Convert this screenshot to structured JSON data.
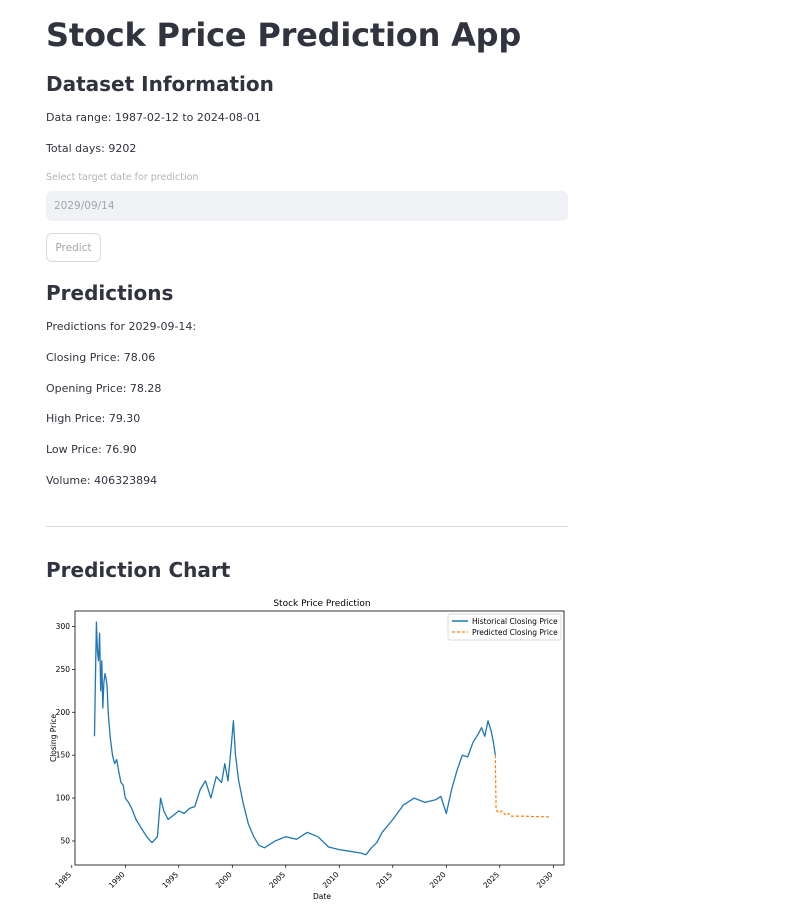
{
  "app": {
    "title": "Stock Price Prediction App"
  },
  "dataset": {
    "heading": "Dataset Information",
    "range_text": "Data range: 1987-02-12 to 2024-08-01",
    "total_days_text": "Total days: 9202"
  },
  "date_input": {
    "label": "Select target date for prediction",
    "value": "2029/09/14"
  },
  "predict_button": {
    "label": "Predict"
  },
  "predictions": {
    "heading": "Predictions",
    "for_text": "Predictions for 2029-09-14:",
    "closing": "Closing Price: 78.06",
    "opening": "Opening Price: 78.28",
    "high": "High Price: 79.30",
    "low": "Low Price: 76.90",
    "volume": "Volume: 406323894"
  },
  "chart_section": {
    "heading": "Prediction Chart"
  },
  "colors": {
    "historical": "#1f77b4",
    "predicted": "#ff7f0e"
  },
  "chart_data": {
    "type": "line",
    "title": "Stock Price Prediction",
    "xlabel": "Date",
    "ylabel": "Closing Price",
    "xlim": [
      1985.3,
      2031.0
    ],
    "ylim": [
      22,
      318
    ],
    "xticks": [
      1985,
      1990,
      1995,
      2000,
      2005,
      2010,
      2015,
      2020,
      2025,
      2030
    ],
    "yticks": [
      50,
      100,
      150,
      200,
      250,
      300
    ],
    "grid": false,
    "legend_position": "top-right",
    "series": [
      {
        "name": "Historical Closing Price",
        "style": "solid",
        "x": [
          1987.12,
          1987.2,
          1987.3,
          1987.4,
          1987.5,
          1987.6,
          1987.7,
          1987.8,
          1987.9,
          1988.0,
          1988.1,
          1988.2,
          1988.3,
          1988.4,
          1988.5,
          1988.6,
          1988.7,
          1988.8,
          1989.0,
          1989.2,
          1989.4,
          1989.6,
          1989.8,
          1990.0,
          1990.3,
          1990.6,
          1991.0,
          1991.5,
          1992.0,
          1992.5,
          1993.0,
          1993.3,
          1993.6,
          1994.0,
          1994.5,
          1995.0,
          1995.5,
          1996.0,
          1996.5,
          1997.0,
          1997.5,
          1998.0,
          1998.5,
          1999.0,
          1999.3,
          1999.6,
          1999.9,
          2000.1,
          2000.3,
          2000.6,
          2001.0,
          2001.5,
          2002.0,
          2002.5,
          2003.0,
          2004.0,
          2005.0,
          2006.0,
          2007.0,
          2008.0,
          2009.0,
          2010.0,
          2011.0,
          2012.0,
          2012.5,
          2013.0,
          2013.5,
          2014.0,
          2015.0,
          2016.0,
          2017.0,
          2018.0,
          2019.0,
          2019.5,
          2020.0,
          2020.5,
          2021.0,
          2021.5,
          2022.0,
          2022.5,
          2023.0,
          2023.3,
          2023.6,
          2023.9,
          2024.2,
          2024.4,
          2024.58
        ],
        "values": [
          172,
          230,
          305,
          270,
          260,
          292,
          225,
          260,
          205,
          235,
          245,
          240,
          230,
          200,
          185,
          170,
          160,
          150,
          140,
          145,
          130,
          118,
          115,
          100,
          95,
          88,
          75,
          65,
          55,
          48,
          55,
          100,
          85,
          75,
          80,
          85,
          82,
          88,
          90,
          110,
          120,
          100,
          125,
          118,
          140,
          120,
          160,
          190,
          150,
          120,
          95,
          70,
          55,
          45,
          42,
          50,
          55,
          52,
          60,
          55,
          43,
          40,
          38,
          36,
          34,
          42,
          48,
          60,
          75,
          92,
          100,
          95,
          98,
          102,
          82,
          110,
          132,
          150,
          148,
          165,
          175,
          182,
          172,
          190,
          178,
          165,
          150
        ]
      },
      {
        "name": "Predicted Closing Price",
        "style": "dashed",
        "x": [
          2024.58,
          2024.65,
          2024.8,
          2025.0,
          2025.2,
          2025.4,
          2025.6,
          2025.8,
          2026.0,
          2027.0,
          2028.0,
          2029.0,
          2029.7
        ],
        "values": [
          150,
          86,
          84,
          83,
          85,
          82,
          80,
          82,
          79,
          79,
          78.5,
          78.3,
          78.06
        ]
      }
    ]
  }
}
